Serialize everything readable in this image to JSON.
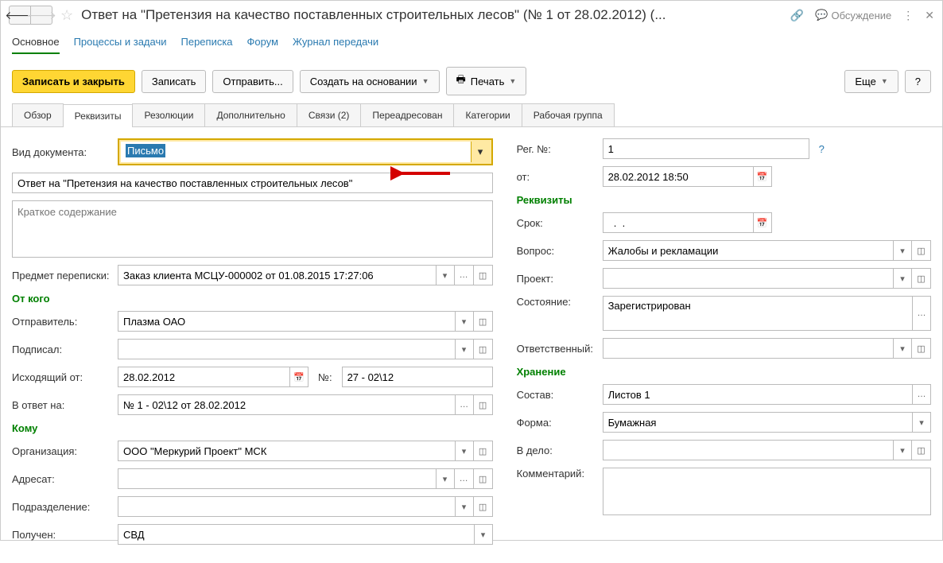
{
  "title": "Ответ на \"Претензия на качество поставленных строительных лесов\" (№ 1 от 28.02.2012) (...",
  "discuss_label": "Обсуждение",
  "menu": {
    "main": "Основное",
    "processes": "Процессы и задачи",
    "correspondence": "Переписка",
    "forum": "Форум",
    "journal": "Журнал передачи"
  },
  "toolbar": {
    "save_close": "Записать и закрыть",
    "save": "Записать",
    "send": "Отправить...",
    "create_based": "Создать на основании",
    "print": "Печать",
    "more": "Еще"
  },
  "tabs": {
    "overview": "Обзор",
    "requisites": "Реквизиты",
    "resolutions": "Резолюции",
    "additional": "Дополнительно",
    "links": "Связи (2)",
    "redirected": "Переадресован",
    "categories": "Категории",
    "workgroup": "Рабочая группа"
  },
  "left": {
    "doc_type_label": "Вид документа:",
    "doc_type_value": "Письмо",
    "subject_value": "Ответ на \"Претензия на качество поставленных строительных лесов\"",
    "summary_placeholder": "Краткое содержание",
    "corr_subject_label": "Предмет переписки:",
    "corr_subject_value": "Заказ клиента МСЦУ-000002 от 01.08.2015 17:27:06",
    "from_section": "От кого",
    "sender_label": "Отправитель:",
    "sender_value": "Плазма ОАО",
    "signed_label": "Подписал:",
    "signed_value": "",
    "outgoing_date_label": "Исходящий от:",
    "outgoing_date_value": "28.02.2012",
    "num_label": "№:",
    "num_value": "27 - 02\\12",
    "reply_to_label": "В ответ на:",
    "reply_to_value": "№ 1 - 02\\12 от 28.02.2012",
    "to_section": "Кому",
    "org_label": "Организация:",
    "org_value": "ООО \"Меркурий Проект\" МСК",
    "addressee_label": "Адресат:",
    "addressee_value": "",
    "dept_label": "Подразделение:",
    "dept_value": "",
    "received_label": "Получен:",
    "received_value": "СВД"
  },
  "right": {
    "reg_num_label": "Рег. №:",
    "reg_num_value": "1",
    "from_date_label": "от:",
    "from_date_value": "28.02.2012 18:50",
    "req_section": "Реквизиты",
    "deadline_label": "Срок:",
    "deadline_value": "  .  .",
    "question_label": "Вопрос:",
    "question_value": "Жалобы и рекламации",
    "project_label": "Проект:",
    "project_value": "",
    "status_label": "Состояние:",
    "status_value": "Зарегистрирован",
    "responsible_label": "Ответственный:",
    "responsible_value": "",
    "storage_section": "Хранение",
    "composition_label": "Состав:",
    "composition_value": "Листов 1",
    "form_label": "Форма:",
    "form_value": "Бумажная",
    "to_case_label": "В дело:",
    "to_case_value": "",
    "comment_label": "Комментарий:"
  }
}
